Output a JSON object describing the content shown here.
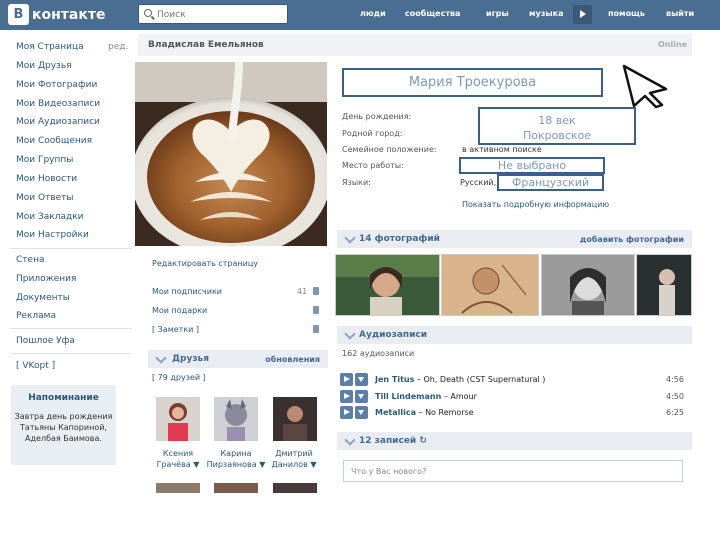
{
  "header": {
    "logo_text": "контакте",
    "logo_badge": "B",
    "search_placeholder": "Поиск",
    "nav": [
      "люди",
      "сообщества",
      "игры",
      "музыка",
      "помощь",
      "выйти"
    ]
  },
  "sidebar": {
    "items": [
      "Моя Страница",
      "Мои Друзья",
      "Мои Фотографии",
      "Мои Видеозаписи",
      "Мои Аудиозаписи",
      "Мои Сообщения",
      "Мои Группы",
      "Мои Новости",
      "Мои Ответы",
      "Мои Закладки",
      "Мои Настройки"
    ],
    "edit_label": "ред.",
    "items2": [
      "Стена",
      "Приложения",
      "Документы",
      "Реклама"
    ],
    "items3": [
      "Пошлое Уфа"
    ],
    "items4": [
      "[ VKopt ]"
    ],
    "reminder_title": "Напоминание",
    "reminder_text": "Завтра день рождения Татьяны Капориной, Аделбая Баимова."
  },
  "profile": {
    "name": "Владислав Емельянов",
    "status": "Online",
    "overlay_name": "Мария Троекурова",
    "labels": {
      "birthday": "День рождения:",
      "hometown": "Родной город:",
      "family": "Семейное положение:",
      "work": "Место работы:",
      "languages": "Языки:"
    },
    "values": {
      "family": "в активном поиске",
      "languages": "Русский,"
    },
    "overlay_birthday": "18 век",
    "overlay_hometown": "Покровское",
    "overlay_work": "Не выбрано",
    "overlay_languages": "Французский",
    "show_more": "Показать подробную информацию",
    "actions": {
      "edit": "Редактировать страницу",
      "subscribers": "Мои подписчики",
      "subscribers_count": "41",
      "gifts": "Мои подарки",
      "notes": "[ Заметки ]"
    }
  },
  "photos": {
    "title": "14 фотографий",
    "add": "добавить фотографии"
  },
  "friends": {
    "title": "Друзья",
    "updates": "обновления",
    "count": "[ 79 друзей ]",
    "list": [
      {
        "first": "Ксения",
        "last": "Грачёва ▼"
      },
      {
        "first": "Карина",
        "last": "Пирзаянова ▼"
      },
      {
        "first": "Дмитрий",
        "last": "Данилов ▼"
      }
    ]
  },
  "audio": {
    "title": "Аудиозаписи",
    "count": "162 аудиозаписи",
    "tracks": [
      {
        "artist": "Jen Titus",
        "title": " – Oh, Death (CST Supernatural )",
        "duration": "4:56"
      },
      {
        "artist": "Till Lindemann",
        "title": " – Amour",
        "duration": "4:50"
      },
      {
        "artist": "Metallica",
        "title": " – No Remorse",
        "duration": "6:25"
      }
    ]
  },
  "wall": {
    "title": "12 записей ↻",
    "placeholder": "Что у Вас нового?"
  }
}
